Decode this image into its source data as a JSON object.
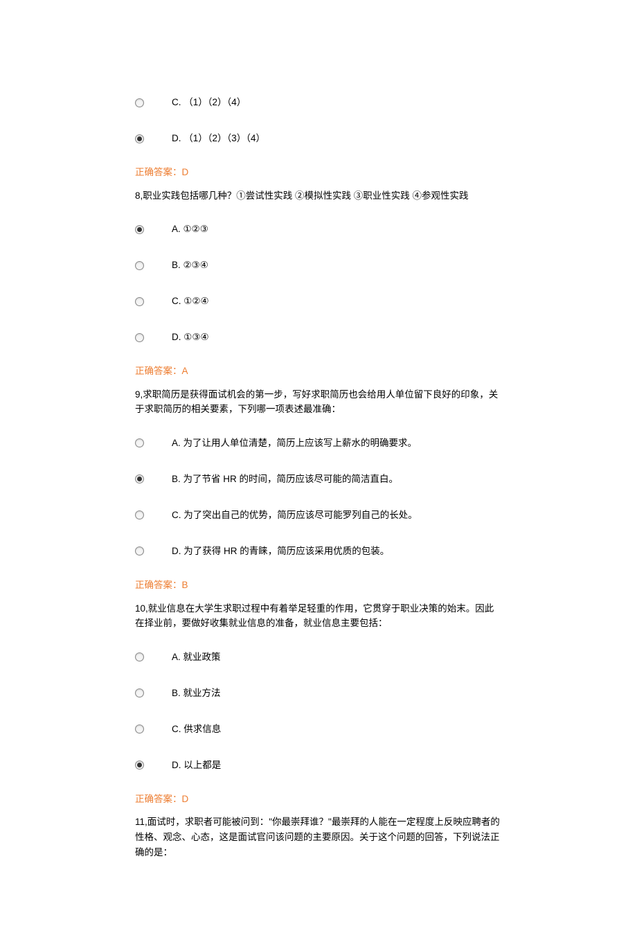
{
  "blocks": [
    {
      "type": "options",
      "spacing": "tall",
      "items": [
        {
          "label": "C. （1）（2）（4）",
          "selected": false
        },
        {
          "label": "D. （1）（2）（3）（4）",
          "selected": true
        }
      ]
    },
    {
      "type": "answer",
      "text": "正确答案：D"
    },
    {
      "type": "question",
      "text": "8,职业实践包括哪几种？①尝试性实践 ②模拟性实践 ③职业性实践 ④参观性实践"
    },
    {
      "type": "options",
      "spacing": "tall",
      "items": [
        {
          "label": "A.  ①②③",
          "selected": true
        },
        {
          "label": "B.  ②③④",
          "selected": false
        },
        {
          "label": "C.  ①②④",
          "selected": false
        },
        {
          "label": "D.  ①③④",
          "selected": false
        }
      ]
    },
    {
      "type": "answer",
      "text": "正确答案：A"
    },
    {
      "type": "question",
      "text": "9,求职简历是获得面试机会的第一步，写好求职简历也会给用人单位留下良好的印象，关于求职简历的相关要素，下列哪一项表述最准确："
    },
    {
      "type": "options",
      "spacing": "tall",
      "items": [
        {
          "label": "A.  为了让用人单位清楚，简历上应该写上薪水的明确要求。",
          "selected": false
        },
        {
          "label": "B.  为了节省 HR 的时间，简历应该尽可能的简洁直白。",
          "selected": true
        },
        {
          "label": "C.  为了突出自己的优势，简历应该尽可能罗列自己的长处。",
          "selected": false
        },
        {
          "label": "D.  为了获得 HR 的青睐，简历应该采用优质的包装。",
          "selected": false
        }
      ]
    },
    {
      "type": "answer",
      "text": "正确答案：B"
    },
    {
      "type": "question",
      "text": "10,就业信息在大学生求职过程中有着举足轻重的作用，它贯穿于职业决策的始末。因此在择业前，要做好收集就业信息的准备，就业信息主要包括："
    },
    {
      "type": "options",
      "spacing": "tall",
      "items": [
        {
          "label": "A.  就业政策",
          "selected": false
        },
        {
          "label": "B.  就业方法",
          "selected": false
        },
        {
          "label": "C.  供求信息",
          "selected": false
        },
        {
          "label": "D.  以上都是",
          "selected": true
        }
      ]
    },
    {
      "type": "answer",
      "text": "正确答案：D"
    },
    {
      "type": "question",
      "text": "11,面试时，求职者可能被问到：\"你最崇拜谁？\"最崇拜的人能在一定程度上反映应聘者的性格、观念、心态，这是面试官问该问题的主要原因。关于这个问题的回答，下列说法正确的是："
    }
  ]
}
